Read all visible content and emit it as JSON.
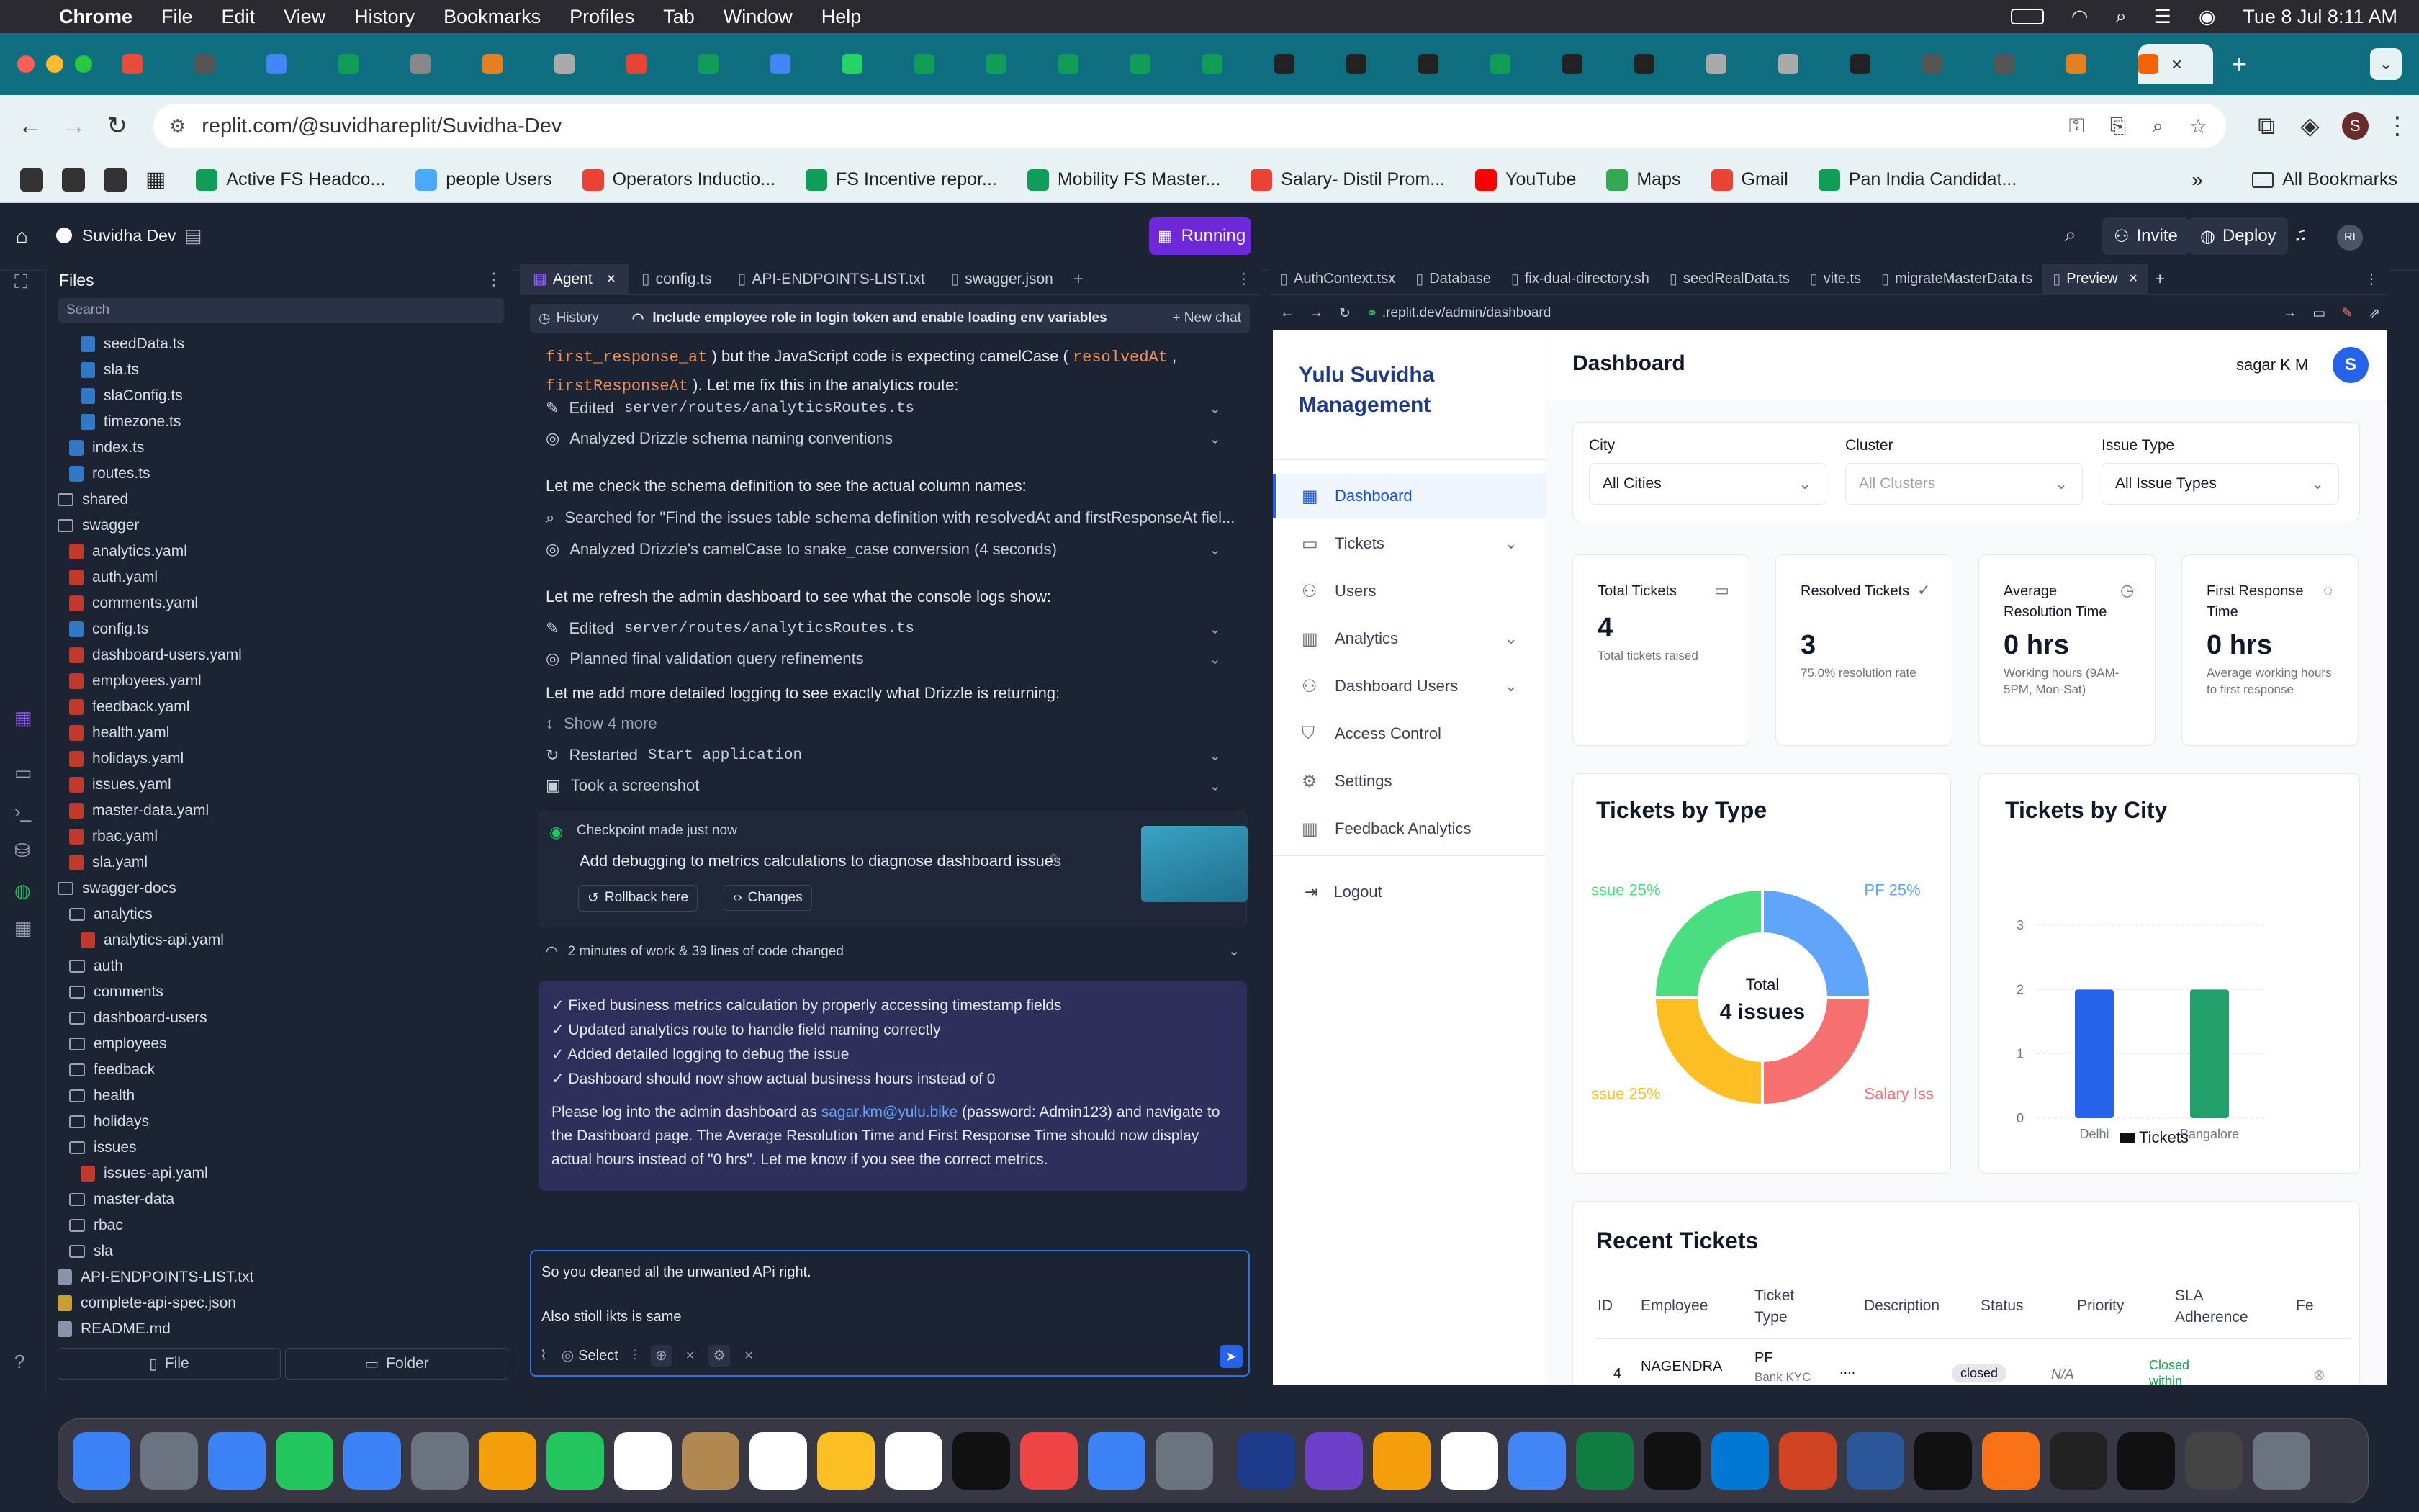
{
  "mac_menu": {
    "app": "Chrome",
    "items": [
      "File",
      "Edit",
      "View",
      "History",
      "Bookmarks",
      "Profiles",
      "Tab",
      "Window",
      "Help"
    ],
    "clock": "Tue 8 Jul  8:11 AM"
  },
  "browser": {
    "url": "replit.com/@suvidhareplit/Suvidha-Dev",
    "bookmarks": [
      "Active FS Headco...",
      "people Users",
      "Operators Inductio...",
      "FS Incentive repor...",
      "Mobility FS Master...",
      "Salary- Distil Prom...",
      "YouTube",
      "Maps",
      "Gmail",
      "Pan India Candidat..."
    ],
    "all_bookmarks": "All Bookmarks"
  },
  "replit": {
    "project": "Suvidha Dev",
    "running": "Running",
    "invite": "Invite",
    "deploy": "Deploy",
    "avatar": "RI",
    "files_title": "Files",
    "search_placeholder": "Search",
    "file_btn": "File",
    "folder_btn": "Folder",
    "tree": [
      {
        "name": "seedData.ts",
        "type": "ts",
        "indent": 1
      },
      {
        "name": "sla.ts",
        "type": "ts",
        "indent": 1
      },
      {
        "name": "slaConfig.ts",
        "type": "ts",
        "indent": 1
      },
      {
        "name": "timezone.ts",
        "type": "ts",
        "indent": 1
      },
      {
        "name": "index.ts",
        "type": "ts",
        "indent": 0
      },
      {
        "name": "routes.ts",
        "type": "ts",
        "indent": 0
      },
      {
        "name": "shared",
        "type": "folder",
        "indent": -1
      },
      {
        "name": "swagger",
        "type": "folder-open",
        "indent": -1
      },
      {
        "name": "analytics.yaml",
        "type": "yaml",
        "indent": 0
      },
      {
        "name": "auth.yaml",
        "type": "yaml",
        "indent": 0
      },
      {
        "name": "comments.yaml",
        "type": "yaml",
        "indent": 0
      },
      {
        "name": "config.ts",
        "type": "ts",
        "indent": 0
      },
      {
        "name": "dashboard-users.yaml",
        "type": "yaml",
        "indent": 0
      },
      {
        "name": "employees.yaml",
        "type": "yaml",
        "indent": 0
      },
      {
        "name": "feedback.yaml",
        "type": "yaml",
        "indent": 0
      },
      {
        "name": "health.yaml",
        "type": "yaml",
        "indent": 0
      },
      {
        "name": "holidays.yaml",
        "type": "yaml",
        "indent": 0
      },
      {
        "name": "issues.yaml",
        "type": "yaml",
        "indent": 0
      },
      {
        "name": "master-data.yaml",
        "type": "yaml",
        "indent": 0
      },
      {
        "name": "rbac.yaml",
        "type": "yaml",
        "indent": 0
      },
      {
        "name": "sla.yaml",
        "type": "yaml",
        "indent": 0
      },
      {
        "name": "swagger-docs",
        "type": "folder-open",
        "indent": -1
      },
      {
        "name": "analytics",
        "type": "folder-open",
        "indent": 0
      },
      {
        "name": "analytics-api.yaml",
        "type": "yaml",
        "indent": 1
      },
      {
        "name": "auth",
        "type": "folder",
        "indent": 0
      },
      {
        "name": "comments",
        "type": "folder",
        "indent": 0
      },
      {
        "name": "dashboard-users",
        "type": "folder",
        "indent": 0
      },
      {
        "name": "employees",
        "type": "folder",
        "indent": 0
      },
      {
        "name": "feedback",
        "type": "folder",
        "indent": 0
      },
      {
        "name": "health",
        "type": "folder",
        "indent": 0
      },
      {
        "name": "holidays",
        "type": "folder",
        "indent": 0
      },
      {
        "name": "issues",
        "type": "folder-open",
        "indent": 0
      },
      {
        "name": "issues-api.yaml",
        "type": "yaml",
        "indent": 1
      },
      {
        "name": "master-data",
        "type": "folder",
        "indent": 0
      },
      {
        "name": "rbac",
        "type": "folder",
        "indent": 0
      },
      {
        "name": "sla",
        "type": "folder",
        "indent": 0
      },
      {
        "name": "API-ENDPOINTS-LIST.txt",
        "type": "txt",
        "indent": -1
      },
      {
        "name": "complete-api-spec.json",
        "type": "json",
        "indent": -1
      },
      {
        "name": "README.md",
        "type": "md",
        "indent": -1
      }
    ],
    "center_tabs": [
      "Agent",
      "config.ts",
      "API-ENDPOINTS-LIST.txt",
      "swagger.json"
    ],
    "history": "History",
    "chat_title": "Include employee role in login token and enable loading env variables",
    "new_chat": "New chat",
    "log_top": {
      "a": "first_response_at",
      "b": ") but the JavaScript code is expecting camelCase (",
      "c": "resolvedAt",
      "d": "firstResponseAt",
      "e": "). Let me fix this in the analytics route:"
    },
    "log": [
      {
        "icon": "✎",
        "text": "Edited",
        "code": "server/routes/analyticsRoutes.ts",
        "chev": true
      },
      {
        "icon": "◎",
        "text": "Analyzed Drizzle schema naming conventions",
        "chev": true
      },
      {
        "plain": "Let me check the schema definition to see the actual column names:"
      },
      {
        "icon": "⌕",
        "text": "Searched for \"Find the issues table schema definition with resolvedAt and firstResponseAt fiel...",
        "chev": true
      },
      {
        "icon": "◎",
        "text": "Analyzed Drizzle's camelCase to snake_case conversion (4 seconds)",
        "chev": true
      },
      {
        "plain": "Let me refresh the admin dashboard to see what the console logs show:"
      },
      {
        "icon": "✎",
        "text": "Edited",
        "code": "server/routes/analyticsRoutes.ts",
        "chev": true
      },
      {
        "icon": "◎",
        "text": "Planned final validation query refinements",
        "chev": true
      },
      {
        "plain": "Let me add more detailed logging to see exactly what Drizzle is returning:"
      },
      {
        "icon": "↕",
        "text": "Show 4 more",
        "muted": true
      },
      {
        "icon": "↻",
        "text": "Restarted",
        "code": "Start application",
        "chev": true
      },
      {
        "icon": "▣",
        "text": "Took a screenshot",
        "chev": true
      }
    ],
    "checkpoint": {
      "title": "Checkpoint made just now",
      "desc": "Add debugging to metrics calculations to diagnose dashboard issues",
      "rollback": "Rollback here",
      "changes": "Changes"
    },
    "work_summary": "2 minutes of work & 39 lines of code changed",
    "summary": [
      "✓ Fixed business metrics calculation by properly accessing timestamp fields",
      "✓ Updated analytics route to handle field naming correctly",
      "✓ Added detailed logging to debug the issue",
      "✓ Dashboard should now show actual business hours instead of 0"
    ],
    "final_a": "Please log into the admin dashboard as ",
    "final_email": "sagar.km@yulu.bike",
    "final_b": " (password: Admin123) and navigate to the Dashboard page. The Average Resolution Time and First Response Time should now display actual hours instead of \"0 hrs\". Let me know if you see the correct metrics.",
    "input_line1": "So you cleaned all the unwanted APi right.",
    "input_line2": "Also stioll ikts is same",
    "select": "Select",
    "right_tabs": [
      "AuthContext.tsx",
      "Database",
      "fix-dual-directory.sh",
      "seedRealData.ts",
      "vite.ts",
      "migrateMasterData.ts",
      "Preview"
    ],
    "preview_url": ".replit.dev/admin/dashboard"
  },
  "app": {
    "brand": "Yulu Suvidha Management",
    "nav": [
      {
        "label": "Dashboard",
        "icon": "grid-icon",
        "active": true
      },
      {
        "label": "Tickets",
        "icon": "ticket-icon",
        "chev": true
      },
      {
        "label": "Users",
        "icon": "users-icon"
      },
      {
        "label": "Analytics",
        "icon": "bar-chart-icon",
        "chev": true
      },
      {
        "label": "Dashboard Users",
        "icon": "user-group-icon",
        "chev": true
      },
      {
        "label": "Access Control",
        "icon": "shield-icon"
      },
      {
        "label": "Settings",
        "icon": "gear-icon"
      },
      {
        "label": "Feedback Analytics",
        "icon": "bar-chart-icon"
      }
    ],
    "logout": "Logout",
    "page_title": "Dashboard",
    "user_name": "sagar K M",
    "user_initial": "S",
    "filters": [
      {
        "label": "City",
        "value": "All Cities"
      },
      {
        "label": "Cluster",
        "value": "All Clusters",
        "muted": true
      },
      {
        "label": "Issue Type",
        "value": "All Issue Types"
      }
    ],
    "kpis": [
      {
        "title": "Total Tickets",
        "value": "4",
        "sub": "Total tickets raised"
      },
      {
        "title": "Resolved Tickets",
        "value": "3",
        "sub": "75.0% resolution rate"
      },
      {
        "title": "Average Resolution Time",
        "value": "0 hrs",
        "sub": "Working hours (9AM-5PM, Mon-Sat)"
      },
      {
        "title": "First Response Time",
        "value": "0 hrs",
        "sub": "Average working hours to first response"
      }
    ],
    "recent_title": "Recent Tickets",
    "table_headers": [
      "ID",
      "Employee",
      "Ticket Type",
      "Description",
      "Status",
      "Priority",
      "SLA Adherence",
      "Fe"
    ],
    "table_row": {
      "id": "4",
      "employee": "NAGENDRA",
      "type": "PF",
      "type_sub": "Bank KYC",
      "desc": "....",
      "status": "closed",
      "priority": "N/A",
      "sla": "Closed within"
    }
  },
  "chart_data": [
    {
      "type": "pie",
      "title": "Tickets by Type",
      "center_label": "Total",
      "center_value": "4 issues",
      "slices": [
        {
          "label": "PF 25%",
          "value": 25,
          "color": "#60a5fa"
        },
        {
          "label": "Salary Iss",
          "value": 25,
          "color": "#f87171"
        },
        {
          "label": "ssue 25%",
          "value": 25,
          "color": "#fbbf24"
        },
        {
          "label": "ssue 25%",
          "value": 25,
          "color": "#4ade80"
        }
      ]
    },
    {
      "type": "bar",
      "title": "Tickets by City",
      "categories": [
        "Delhi",
        "Bangalore"
      ],
      "series": [
        {
          "name": "Tickets",
          "values": [
            2,
            2
          ]
        }
      ],
      "ylim": [
        0,
        3
      ],
      "yticks": [
        "0",
        "1",
        "2",
        "3"
      ],
      "colors": [
        "#2563eb",
        "#22a06b"
      ]
    }
  ],
  "colors": {
    "accent": "#2563eb",
    "replit_bg": "#1c2333",
    "running": "#6d28d9"
  }
}
